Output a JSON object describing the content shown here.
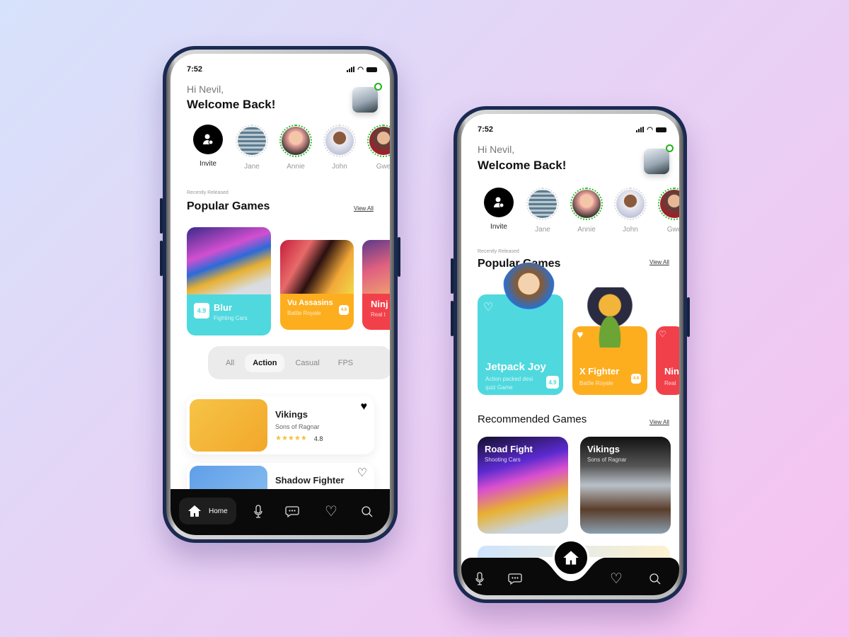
{
  "colors": {
    "teal": "#4fd9de",
    "orange": "#fdae1f",
    "red": "#f2404a",
    "online": "#1fb317",
    "black": "#0a0a0a",
    "star": "#f4c23a"
  },
  "status": {
    "time": "7:52",
    "icons": [
      "signal-icon",
      "wifi-icon",
      "battery-icon"
    ]
  },
  "greeting": {
    "hi": "Hi Nevil,",
    "welcome": "Welcome Back!"
  },
  "stories": [
    {
      "name": "Invite",
      "type": "invite"
    },
    {
      "name": "Jane",
      "online": false
    },
    {
      "name": "Annie",
      "online": true
    },
    {
      "name": "John",
      "online": false
    },
    {
      "name": "Gwe",
      "online": true
    }
  ],
  "popular": {
    "eyebrow": "Recently Released",
    "title": "Popular Games",
    "view_all": "View All"
  },
  "left": {
    "games": [
      {
        "name": "Blur",
        "sub": "Fighting Cars",
        "rating": "4.9",
        "color": "#4fd9de"
      },
      {
        "name": "Vu Assasins",
        "sub": "Battle Royale",
        "rating": "4.6",
        "color": "#fdae1f"
      },
      {
        "name": "Ninj",
        "sub": "Real t",
        "color": "#f2404a"
      }
    ],
    "filters": [
      "All",
      "Action",
      "Casual",
      "FPS"
    ],
    "active_filter": "Action",
    "list": [
      {
        "title": "Vikings",
        "sub": "Sons of Ragnar",
        "rating": "4.8",
        "stars": "★★★★★",
        "liked": true
      },
      {
        "title": "Shadow Fighter",
        "liked": false
      }
    ],
    "nav": {
      "home": "Home",
      "icons": [
        "home-icon",
        "mic-icon",
        "chat-icon",
        "heart-icon",
        "search-icon"
      ]
    }
  },
  "right": {
    "games": [
      {
        "name": "Jetpack Joy",
        "sub": "Action packed desi quiz Game",
        "rating": "4.9",
        "color": "#4fd9de"
      },
      {
        "name": "X Fighter",
        "sub": "Battle Royale",
        "rating": "4.6",
        "color": "#fdae1f"
      },
      {
        "name": "Nin",
        "sub": "Real",
        "color": "#f2404a"
      }
    ],
    "recommended": {
      "title": "Recommended Games",
      "view_all": "View All",
      "items": [
        {
          "title": "Road Fight",
          "sub": "Shooting Cars"
        },
        {
          "title": "Vikings",
          "sub": "Sons of Ragnar"
        }
      ]
    },
    "nav": {
      "icons": [
        "mic-icon",
        "chat-icon",
        "home-icon",
        "heart-icon",
        "search-icon"
      ]
    }
  }
}
